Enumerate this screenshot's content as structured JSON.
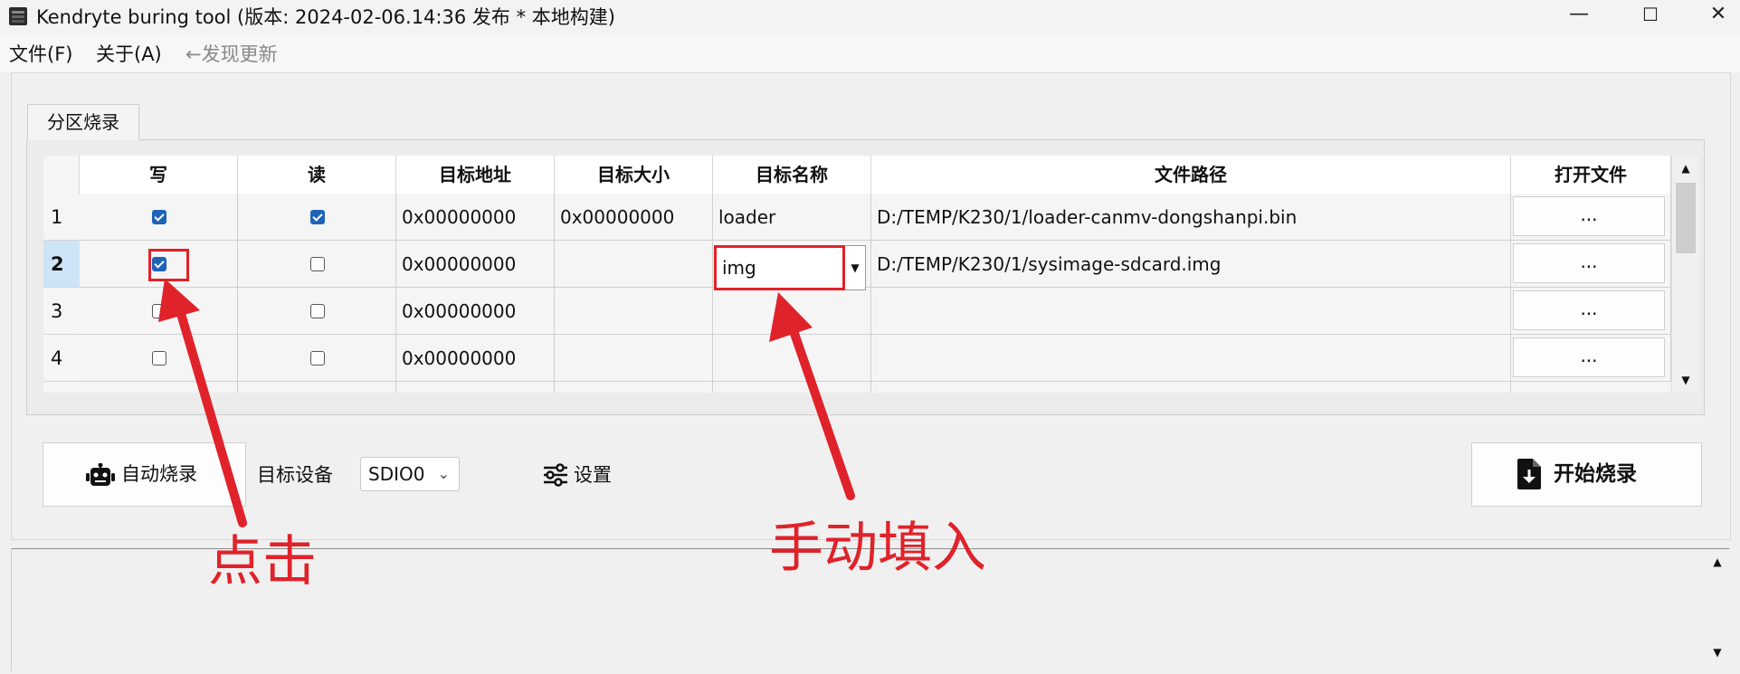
{
  "window": {
    "title": "Kendryte buring tool (版本: 2024-02-06.14:36 发布 * 本地构建)",
    "minimize_glyph": "—",
    "maximize_glyph": "☐",
    "close_glyph": "✕"
  },
  "menubar": {
    "items": [
      "文件(F)",
      "关于(A)"
    ],
    "update_notice": "←发现更新"
  },
  "tab": {
    "label": "分区烧录"
  },
  "table": {
    "columns": [
      "写",
      "读",
      "目标地址",
      "目标大小",
      "目标名称",
      "文件路径",
      "打开文件"
    ],
    "rows": [
      {
        "index": "1",
        "write": true,
        "read": true,
        "address": "0x00000000",
        "size": "0x00000000",
        "name": "loader",
        "path": "D:/TEMP/K230/1/loader-canmv-dongshanpi.bin",
        "open": "..."
      },
      {
        "index": "2",
        "write": true,
        "read": false,
        "address": "0x00000000",
        "size": "",
        "name": "img",
        "path": "D:/TEMP/K230/1/sysimage-sdcard.img",
        "open": "...",
        "selected": true,
        "name_editing": true
      },
      {
        "index": "3",
        "write": false,
        "read": false,
        "address": "0x00000000",
        "size": "",
        "name": "",
        "path": "",
        "open": "..."
      },
      {
        "index": "4",
        "write": false,
        "read": false,
        "address": "0x00000000",
        "size": "",
        "name": "",
        "path": "",
        "open": "..."
      }
    ],
    "scroll_up_glyph": "▲",
    "scroll_down_glyph": "▼",
    "combo_arrow_glyph": "▼"
  },
  "controls": {
    "auto_burn_label": "自动烧录",
    "auto_burn_icon": "robot-icon",
    "target_device_label": "目标设备",
    "target_device_value": "SDIO0",
    "select_arrow": "⌄",
    "settings_label": "设置",
    "settings_icon": "sliders-icon",
    "start_burn_label": "开始烧录",
    "start_burn_icon": "file-download-icon"
  },
  "log": {
    "scroll_up_glyph": "▲",
    "scroll_down_glyph": "▼"
  },
  "annotations": {
    "click_text": "点击",
    "manual_text": "手动填入",
    "color": "#e0222a"
  }
}
